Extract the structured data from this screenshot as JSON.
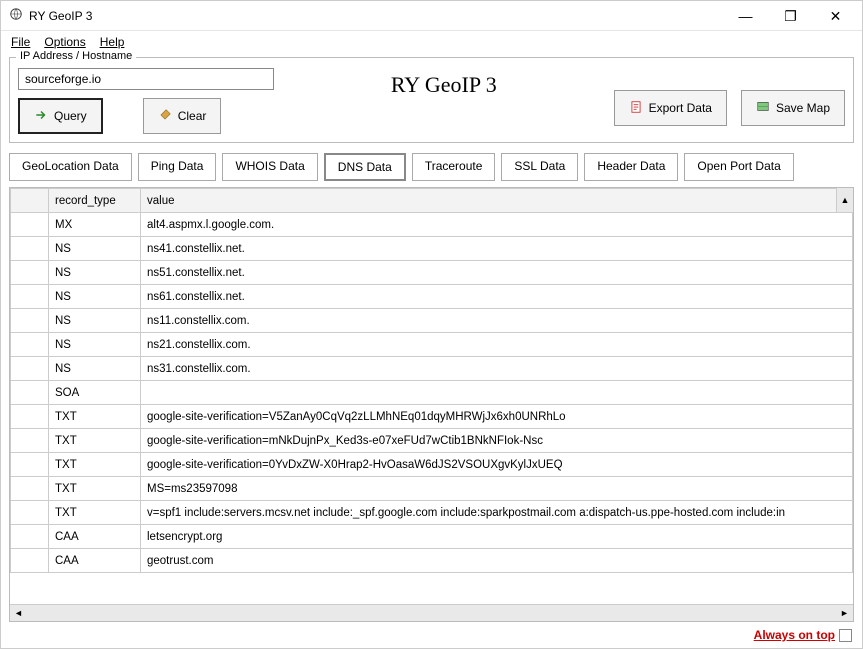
{
  "window": {
    "title": "RY GeoIP 3",
    "minimize": "—",
    "maximize": "❐",
    "close": "✕"
  },
  "menubar": [
    "File",
    "Options",
    "Help"
  ],
  "fieldset_label": "IP Address / Hostname",
  "hostname_input": "sourceforge.io",
  "buttons": {
    "query": "Query",
    "clear": "Clear",
    "export_data": "Export Data",
    "save_map": "Save Map"
  },
  "app_title": "RY GeoIP 3",
  "tabs": {
    "items": [
      "GeoLocation Data",
      "Ping Data",
      "WHOIS Data",
      "DNS Data",
      "Traceroute",
      "SSL Data",
      "Header Data",
      "Open Port Data"
    ],
    "active_index": 3
  },
  "table": {
    "headers": [
      "",
      "record_type",
      "value"
    ],
    "rows": [
      {
        "record_type": "MX",
        "value": "alt4.aspmx.l.google.com."
      },
      {
        "record_type": "NS",
        "value": "ns41.constellix.net."
      },
      {
        "record_type": "NS",
        "value": "ns51.constellix.net."
      },
      {
        "record_type": "NS",
        "value": "ns61.constellix.net."
      },
      {
        "record_type": "NS",
        "value": "ns11.constellix.com."
      },
      {
        "record_type": "NS",
        "value": "ns21.constellix.com."
      },
      {
        "record_type": "NS",
        "value": "ns31.constellix.com."
      },
      {
        "record_type": "SOA",
        "value": ""
      },
      {
        "record_type": "TXT",
        "value": "google-site-verification=V5ZanAy0CqVq2zLLMhNEq01dqyMHRWjJx6xh0UNRhLo"
      },
      {
        "record_type": "TXT",
        "value": "google-site-verification=mNkDujnPx_Ked3s-e07xeFUd7wCtib1BNkNFIok-Nsc"
      },
      {
        "record_type": "TXT",
        "value": "google-site-verification=0YvDxZW-X0Hrap2-HvOasaW6dJS2VSOUXgvKylJxUEQ"
      },
      {
        "record_type": "TXT",
        "value": "MS=ms23597098"
      },
      {
        "record_type": "TXT",
        "value": "v=spf1 include:servers.mcsv.net include:_spf.google.com include:sparkpostmail.com a:dispatch-us.ppe-hosted.com include:in"
      },
      {
        "record_type": "CAA",
        "value": "letsencrypt.org"
      },
      {
        "record_type": "CAA",
        "value": "geotrust.com"
      }
    ]
  },
  "footer": {
    "always_on_top": "Always on top"
  }
}
